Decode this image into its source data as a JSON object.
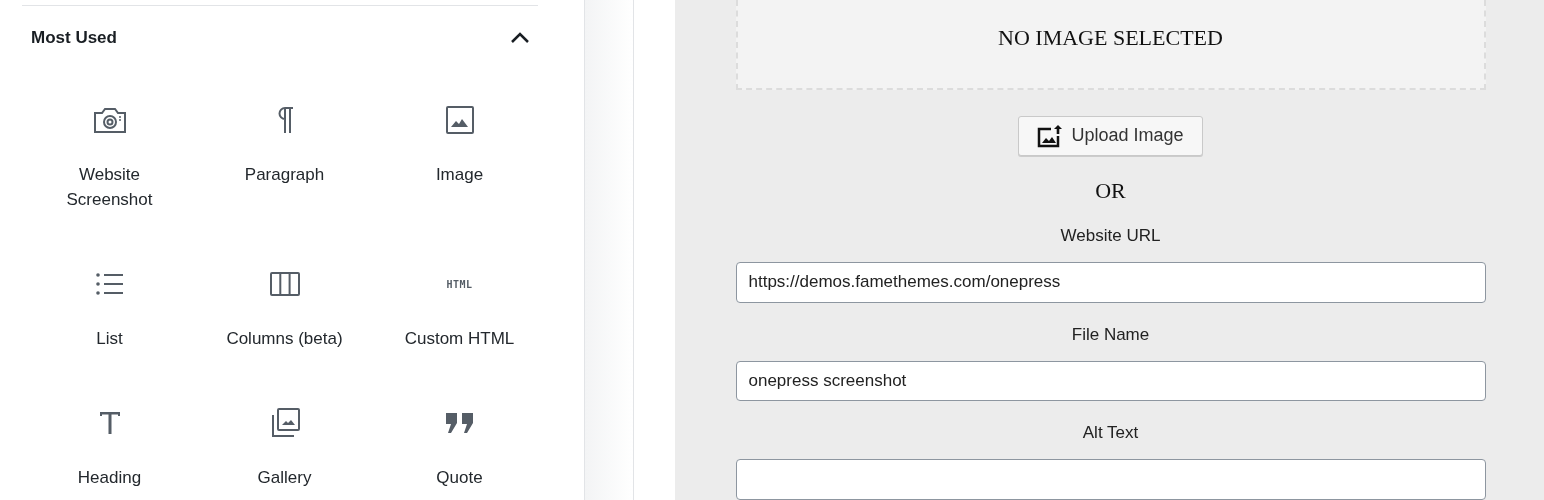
{
  "inserter": {
    "section": {
      "title": "Most Used",
      "expanded": true
    },
    "blocks": [
      {
        "kind": "camera",
        "label": "Website Screenshot"
      },
      {
        "kind": "paragraph",
        "label": "Paragraph"
      },
      {
        "kind": "image",
        "label": "Image"
      },
      {
        "kind": "list",
        "label": "List"
      },
      {
        "kind": "columns",
        "label": "Columns (beta)"
      },
      {
        "kind": "html",
        "label": "Custom HTML",
        "icon_text": "HTML"
      },
      {
        "kind": "heading",
        "label": "Heading"
      },
      {
        "kind": "gallery",
        "label": "Gallery"
      },
      {
        "kind": "quote",
        "label": "Quote"
      }
    ]
  },
  "screenshot_block": {
    "preview_text": "NO IMAGE SELECTED",
    "upload_button": "Upload Image",
    "or_text": "OR",
    "fields": [
      {
        "label": "Website URL",
        "value": "https://demos.famethemes.com/onepress"
      },
      {
        "label": "File Name",
        "value": "onepress screenshot"
      },
      {
        "label": "Alt Text"
      }
    ]
  }
}
